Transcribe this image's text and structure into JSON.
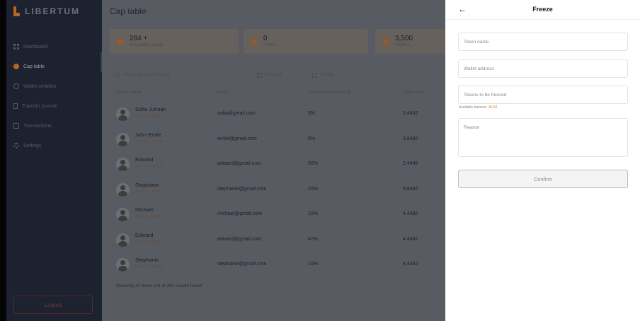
{
  "app": {
    "logo": "LIBERTUM"
  },
  "sidebar": {
    "items": [
      {
        "label": "Dashboard",
        "icon": "dashboard-icon"
      },
      {
        "label": "Cap table",
        "icon": "coin-icon",
        "active": true
      },
      {
        "label": "Wallet whitelist",
        "icon": "wallet-icon"
      },
      {
        "label": "Transfer journal",
        "icon": "journal-icon"
      },
      {
        "label": "Transactions",
        "icon": "transactions-icon"
      },
      {
        "label": "Settings",
        "icon": "gear-icon"
      }
    ],
    "logout_label": "Logout"
  },
  "main": {
    "title": "Cap table",
    "stats": [
      {
        "value": "284 +",
        "label": "Circulating supply"
      },
      {
        "value": "0",
        "label": "Frozen"
      },
      {
        "value": "3,500",
        "label": "Holders"
      }
    ],
    "search_placeholder": "Search by name & email",
    "filter1": "Standard",
    "filter2": "Holding",
    "columns": [
      "Holder Name",
      "Email",
      "Percentage Ownership",
      "Token num"
    ],
    "rows": [
      {
        "name": "Sofia Juhaan",
        "sub": "ACTIVE · WHITE",
        "email": "sofia@gmail.com",
        "pct": "5%",
        "tokens": "3.4482"
      },
      {
        "name": "John Emile",
        "sub": "ACTIVE · WHITE",
        "email": "emile@gmail.com",
        "pct": "8%",
        "tokens": "3.6482"
      },
      {
        "name": "Edward",
        "sub": "ACTIVE · WHITE",
        "email": "edward@gmail.com",
        "pct": "50%",
        "tokens": "2.4445"
      },
      {
        "name": "Stephanie",
        "sub": "ACTIVE · WHITE",
        "email": "stephanie@gmail.com",
        "pct": "20%",
        "tokens": "5.6482"
      },
      {
        "name": "Michael",
        "sub": "ACTIVE · WHITE",
        "email": "michael@gmail.com",
        "pct": "16%",
        "tokens": "4.4482"
      },
      {
        "name": "Edward",
        "sub": "ACTIVE · WHITE",
        "email": "edward@gmail.com",
        "pct": "40%",
        "tokens": "4.4482"
      },
      {
        "name": "Stephanie",
        "sub": "ACTIVE · WHITE",
        "email": "stephanie@gmail.com",
        "pct": "10%",
        "tokens": "4.4482"
      }
    ],
    "footer": "Showing 10 items out of 250 results found"
  },
  "drawer": {
    "title": "Freeze",
    "token_name_placeholder": "Token name",
    "wallet_placeholder": "Wallet address",
    "tokens_placeholder": "Tokens to be freezed",
    "available_label": "Available balance:",
    "available_value": "30.52",
    "reason_placeholder": "Reason",
    "confirm_label": "Confirm"
  },
  "colors": {
    "accent": "#e67e22",
    "overlay": "#585b62",
    "sidebar": "#1d2230"
  }
}
